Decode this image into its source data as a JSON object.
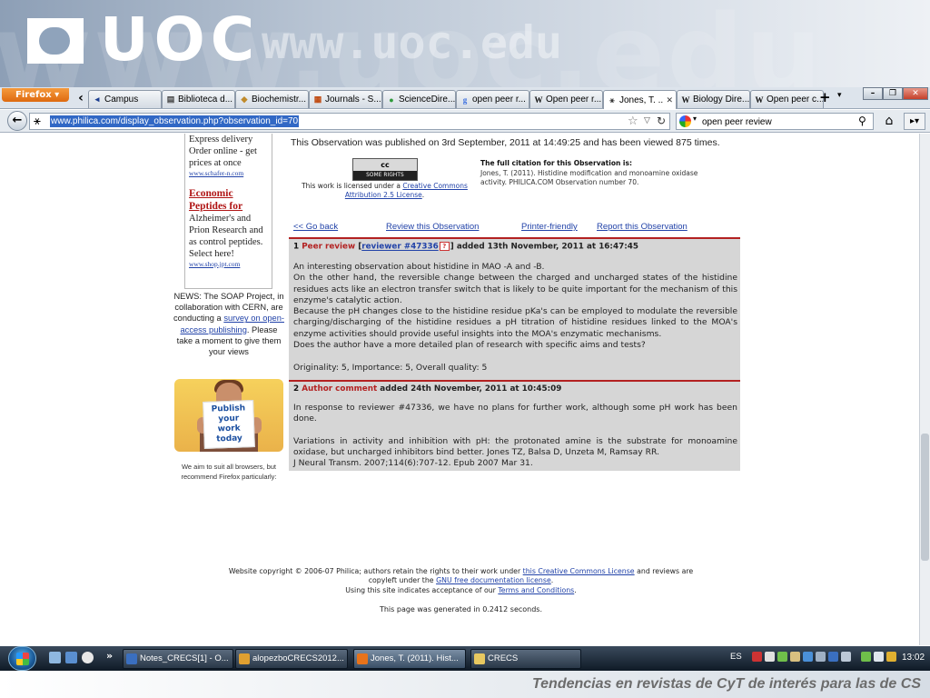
{
  "banner": {
    "logo_text": "UOC",
    "url_watermark": "www.uoc.edu",
    "background_watermark": "www.uoc.edu"
  },
  "browser": {
    "menu_label": "Firefox",
    "tabs": [
      {
        "label": "Campus",
        "icon": "chevron-left-icon"
      },
      {
        "label": "Biblioteca d...",
        "icon": "library-icon"
      },
      {
        "label": "Biochemistr...",
        "icon": "book-icon"
      },
      {
        "label": "Journals - S...",
        "icon": "journal-icon"
      },
      {
        "label": "ScienceDire...",
        "icon": "sciencedirect-icon"
      },
      {
        "label": "open peer r...",
        "icon": "google-icon"
      },
      {
        "label": "Open peer r...",
        "icon": "wikipedia-icon"
      },
      {
        "label": "Jones, T. ...",
        "icon": "philica-icon",
        "active": true
      },
      {
        "label": "Biology Dire...",
        "icon": "wikipedia-icon"
      },
      {
        "label": "Open peer c...",
        "icon": "wikipedia-icon"
      }
    ],
    "url": "www.philica.com/display_observation.php?observation_id=70",
    "search_value": "open peer review"
  },
  "sidebar": {
    "ad1_text": "Express delivery Order online - get prices at once",
    "ad1_link": "www.schafer-n.com",
    "ad2_title": "Economic Peptides for",
    "ad2_text": "Alzheimer's and Prion Research and as control peptides. Select here!",
    "ad2_link": "www.shop.jpt.com",
    "news_prefix": "NEWS: The SOAP Project, in collaboration with CERN, are conducting a",
    "news_link": "survey on open-access publishing",
    "news_suffix": ". Please take a moment to give them your views",
    "promo_lines": [
      "Publish",
      "your",
      "work",
      "today"
    ],
    "browsers_note": "We aim to suit all browsers, but recommend Firefox particularly:"
  },
  "observation": {
    "published": "This Observation was published on 3rd September, 2011 at 14:49:25 and has been viewed 875 times.",
    "cc_badge_top": "cc",
    "cc_badge_bottom": "SOME RIGHTS RESERVED",
    "license_prefix": "This work is licensed under a",
    "license_link": "Creative Commons Attribution 2.5 License",
    "citation_title": "The full citation for this Observation is:",
    "citation_text": "Jones, T. (2011). Histidine modification and monoamine oxidase activity. PHILICA.COM Observation number 70.",
    "actions": {
      "go_back": "<< Go back",
      "review": "Review this Observation",
      "printer": "Printer-friendly",
      "report": "Report this Observation"
    }
  },
  "comments": [
    {
      "number": "1",
      "kind": "Peer review",
      "author_link": "reviewer #47336",
      "date": "added 13th November, 2011 at 16:47:45",
      "paragraphs": [
        "An interesting observation about histidine in MAO -A and -B.",
        "On the other hand, the reversible change between the charged and uncharged states of the histidine residues acts like an electron transfer switch that is likely to be quite important for the mechanism of this enzyme's catalytic action.",
        "Because the pH changes close to the histidine residue pKa's can be employed to modulate the reversible charging/discharging of the histidine residues a pH titration of histidine residues linked to the MOA's enzyme activities should provide useful insights into the MOA's enzymatic mechanisms.",
        "Does the author have a more detailed plan of research with specific aims and tests?"
      ],
      "scores": "Originality: 5, Importance: 5, Overall quality: 5"
    },
    {
      "number": "2",
      "kind": "Author comment",
      "date": "added 24th November, 2011 at 10:45:09",
      "paragraphs": [
        "In response to reviewer #47336, we have no plans for further work, although some pH work has been done.",
        "Variations in activity and inhibition with pH: the protonated amine is the substrate for monoamine oxidase, but uncharged inhibitors bind better. Jones TZ, Balsa D, Unzeta M, Ramsay RR.",
        "J Neural Transm. 2007;114(6):707-12. Epub 2007 Mar 31."
      ]
    }
  ],
  "footer": {
    "copyright_prefix": "Website copyright © 2006-07 Philica; authors retain the rights to their work under",
    "cc_link": "this Creative Commons License",
    "reviews_prefix": "and reviews are copyleft under the",
    "gnu_link": "GNU free documentation license",
    "terms_prefix": "Using this site indicates acceptance of our",
    "terms_link": "Terms and Conditions",
    "generated": "This page was generated in 0.2412 seconds."
  },
  "taskbar": {
    "items": [
      {
        "label": "Notes_CRECS[1] - O...",
        "icon": "word-doc-icon"
      },
      {
        "label": "alopezboCRECS2012...",
        "icon": "image-icon"
      },
      {
        "label": "Jones, T. (2011). Hist...",
        "icon": "firefox-icon",
        "active": true
      },
      {
        "label": "CRECS",
        "icon": "folder-icon"
      }
    ],
    "language": "ES",
    "clock": "13:02"
  },
  "caption": "Tendencias en revistas de CyT de interés para las de CS",
  "colors": {
    "link": "#2142a8",
    "accent_red": "#b32121",
    "comment_bg": "#d6d6d6",
    "url_highlight": "#3168c5"
  }
}
